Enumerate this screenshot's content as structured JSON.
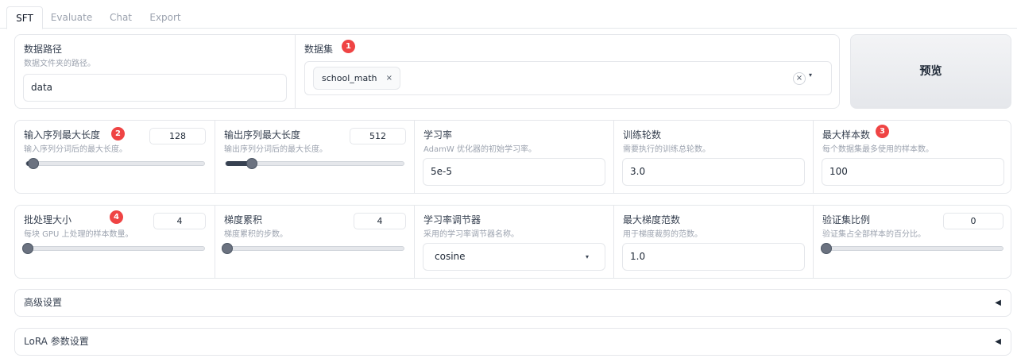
{
  "tabs": [
    "SFT",
    "Evaluate",
    "Chat",
    "Export"
  ],
  "dataset_path": {
    "label": "数据路径",
    "info": "数据文件夹的路径。",
    "value": "data"
  },
  "dataset": {
    "label": "数据集",
    "badge": "1",
    "chip": "school_math",
    "chip_close": "×",
    "clear": "×",
    "caret": "▾"
  },
  "preview_button": "预览",
  "row1": [
    {
      "label": "输入序列最大长度",
      "info": "输入序列分词后的最大长度。",
      "value": "128",
      "badge": "2",
      "slider_fraction": 0.03
    },
    {
      "label": "输出序列最大长度",
      "info": "输出序列分词后的最大长度。",
      "value": "512",
      "slider_fraction": 0.14
    },
    {
      "label": "学习率",
      "info": "AdamW 优化器的初始学习率。",
      "value": "5e-5"
    },
    {
      "label": "训练轮数",
      "info": "需要执行的训练总轮数。",
      "value": "3.0"
    },
    {
      "label": "最大样本数",
      "info": "每个数据集最多使用的样本数。",
      "value": "100",
      "badge": "3"
    }
  ],
  "row2": [
    {
      "label": "批处理大小",
      "info": "每块 GPU 上处理的样本数量。",
      "value": "4",
      "badge": "4",
      "slider_fraction": 0.0
    },
    {
      "label": "梯度累积",
      "info": "梯度累积的步数。",
      "value": "4",
      "slider_fraction": 0.0
    },
    {
      "label": "学习率调节器",
      "info": "采用的学习率调节器名称。",
      "value": "cosine",
      "caret": "▾"
    },
    {
      "label": "最大梯度范数",
      "info": "用于梯度裁剪的范数。",
      "value": "1.0"
    },
    {
      "label": "验证集比例",
      "info": "验证集占全部样本的百分比。",
      "value": "0",
      "slider_fraction": 0.0
    }
  ],
  "accordions": [
    {
      "title": "高级设置",
      "arrow": "◀"
    },
    {
      "title": "LoRA 参数设置",
      "arrow": "◀"
    }
  ],
  "colors": {
    "badge": "#ef4444",
    "slider": "#374151",
    "border": "#e5e7eb"
  }
}
